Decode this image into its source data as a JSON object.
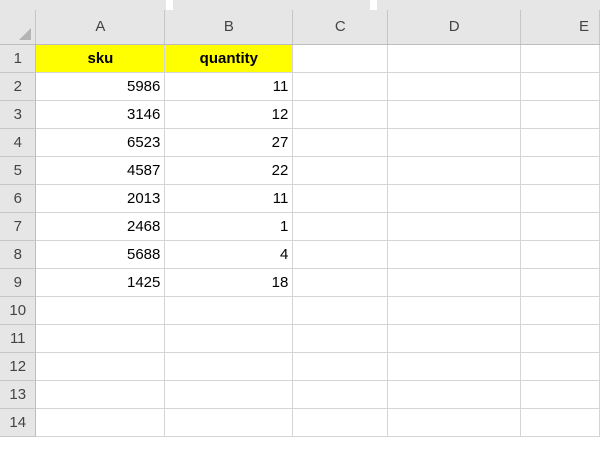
{
  "columns": [
    "A",
    "B",
    "C",
    "D",
    "E"
  ],
  "rows": [
    "1",
    "2",
    "3",
    "4",
    "5",
    "6",
    "7",
    "8",
    "9",
    "10",
    "11",
    "12",
    "13",
    "14"
  ],
  "headers": {
    "sku": "sku",
    "quantity": "quantity"
  },
  "data": [
    {
      "sku": "5986",
      "quantity": "11"
    },
    {
      "sku": "3146",
      "quantity": "12"
    },
    {
      "sku": "6523",
      "quantity": "27"
    },
    {
      "sku": "4587",
      "quantity": "22"
    },
    {
      "sku": "2013",
      "quantity": "11"
    },
    {
      "sku": "2468",
      "quantity": "1"
    },
    {
      "sku": "5688",
      "quantity": "4"
    },
    {
      "sku": "1425",
      "quantity": "18"
    }
  ],
  "colors": {
    "header_fill": "#ffff00",
    "gridline": "#d4d4d4",
    "heading_bg": "#e6e6e6"
  }
}
